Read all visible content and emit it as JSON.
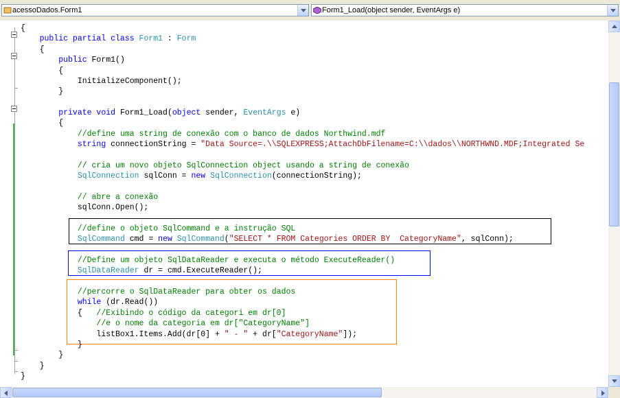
{
  "navigation": {
    "class_combo": {
      "text": "acessoDados.Form1",
      "icon": "class-icon"
    },
    "member_combo": {
      "text": "Form1_Load(object sender, EventArgs e)",
      "icon": "method-icon"
    }
  },
  "code": {
    "lines": [
      [
        [
          "{",
          ""
        ]
      ],
      [
        [
          "    ",
          ""
        ],
        [
          "public partial class ",
          "k"
        ],
        [
          "Form1",
          "t"
        ],
        [
          " : ",
          ""
        ],
        [
          "Form",
          "t"
        ]
      ],
      [
        [
          "    {",
          ""
        ]
      ],
      [
        [
          "        ",
          ""
        ],
        [
          "public ",
          "k"
        ],
        [
          "Form1()",
          ""
        ]
      ],
      [
        [
          "        {",
          ""
        ]
      ],
      [
        [
          "            InitializeComponent();",
          ""
        ]
      ],
      [
        [
          "        }",
          ""
        ]
      ],
      [
        [
          "",
          ""
        ]
      ],
      [
        [
          "        ",
          ""
        ],
        [
          "private void ",
          "k"
        ],
        [
          "Form1_Load(",
          ""
        ],
        [
          "object ",
          "k"
        ],
        [
          "sender, ",
          ""
        ],
        [
          "EventArgs ",
          "t"
        ],
        [
          "e)",
          ""
        ]
      ],
      [
        [
          "        {",
          ""
        ]
      ],
      [
        [
          "            ",
          ""
        ],
        [
          "//define uma string de conexão com o banco de dados Northwind.mdf",
          "c"
        ]
      ],
      [
        [
          "            ",
          ""
        ],
        [
          "string ",
          "k"
        ],
        [
          "connectionString = ",
          ""
        ],
        [
          "\"Data Source=.\\\\SQLEXPRESS;AttachDbFilename=C:\\\\dados\\\\NORTHWND.MDF;Integrated Se",
          "s"
        ]
      ],
      [
        [
          "",
          ""
        ]
      ],
      [
        [
          "            ",
          ""
        ],
        [
          "// cria um novo objeto SqlConnection object usando a string de conexão",
          "c"
        ]
      ],
      [
        [
          "            ",
          ""
        ],
        [
          "SqlConnection ",
          "t"
        ],
        [
          "sqlConn = ",
          ""
        ],
        [
          "new ",
          "k"
        ],
        [
          "SqlConnection",
          "t"
        ],
        [
          "(connectionString);",
          ""
        ]
      ],
      [
        [
          "",
          ""
        ]
      ],
      [
        [
          "            ",
          ""
        ],
        [
          "// abre a conexão",
          "c"
        ]
      ],
      [
        [
          "            sqlConn.Open();",
          ""
        ]
      ],
      [
        [
          "",
          ""
        ]
      ],
      [
        [
          "            ",
          ""
        ],
        [
          "//define o objeto SqlCommand e a instrução SQL",
          "c"
        ]
      ],
      [
        [
          "            ",
          ""
        ],
        [
          "SqlCommand ",
          "t"
        ],
        [
          "cmd = ",
          ""
        ],
        [
          "new ",
          "k"
        ],
        [
          "SqlCommand",
          "t"
        ],
        [
          "(",
          ""
        ],
        [
          "\"SELECT * FROM Categories ORDER BY  CategoryName\"",
          "s"
        ],
        [
          ", sqlConn);",
          ""
        ]
      ],
      [
        [
          "",
          ""
        ]
      ],
      [
        [
          "            ",
          ""
        ],
        [
          "//Define um objeto SqlDataReader e executa o método ExecuteReader()",
          "c"
        ]
      ],
      [
        [
          "            ",
          ""
        ],
        [
          "SqlDataReader ",
          "t"
        ],
        [
          "dr = cmd.ExecuteReader();",
          ""
        ]
      ],
      [
        [
          "",
          ""
        ]
      ],
      [
        [
          "            ",
          ""
        ],
        [
          "//percorre o SqlDataReader para obter os dados",
          "c"
        ]
      ],
      [
        [
          "            ",
          ""
        ],
        [
          "while ",
          "k"
        ],
        [
          "(dr.Read())",
          ""
        ]
      ],
      [
        [
          "            {   ",
          ""
        ],
        [
          "//Exibindo o código da categori em dr[0]",
          "c"
        ]
      ],
      [
        [
          "                ",
          ""
        ],
        [
          "//e o nome da categoria em dr[\"CategoryName\"]",
          "c"
        ]
      ],
      [
        [
          "                listBox1.Items.Add(dr[0] + ",
          ""
        ],
        [
          "\" - \"",
          "s"
        ],
        [
          " + dr[",
          ""
        ],
        [
          "\"CategoryName\"",
          "s"
        ],
        [
          "]);",
          ""
        ]
      ],
      [
        [
          "            }",
          ""
        ]
      ],
      [
        [
          "        }",
          ""
        ]
      ],
      [
        [
          "    }",
          ""
        ]
      ],
      [
        [
          "}",
          ""
        ]
      ]
    ]
  },
  "highlight_colors": {
    "box_command": "#000000",
    "box_reader": "#0000ff",
    "box_loop": "#ff8000",
    "changed_lines": "#3fb34f"
  }
}
